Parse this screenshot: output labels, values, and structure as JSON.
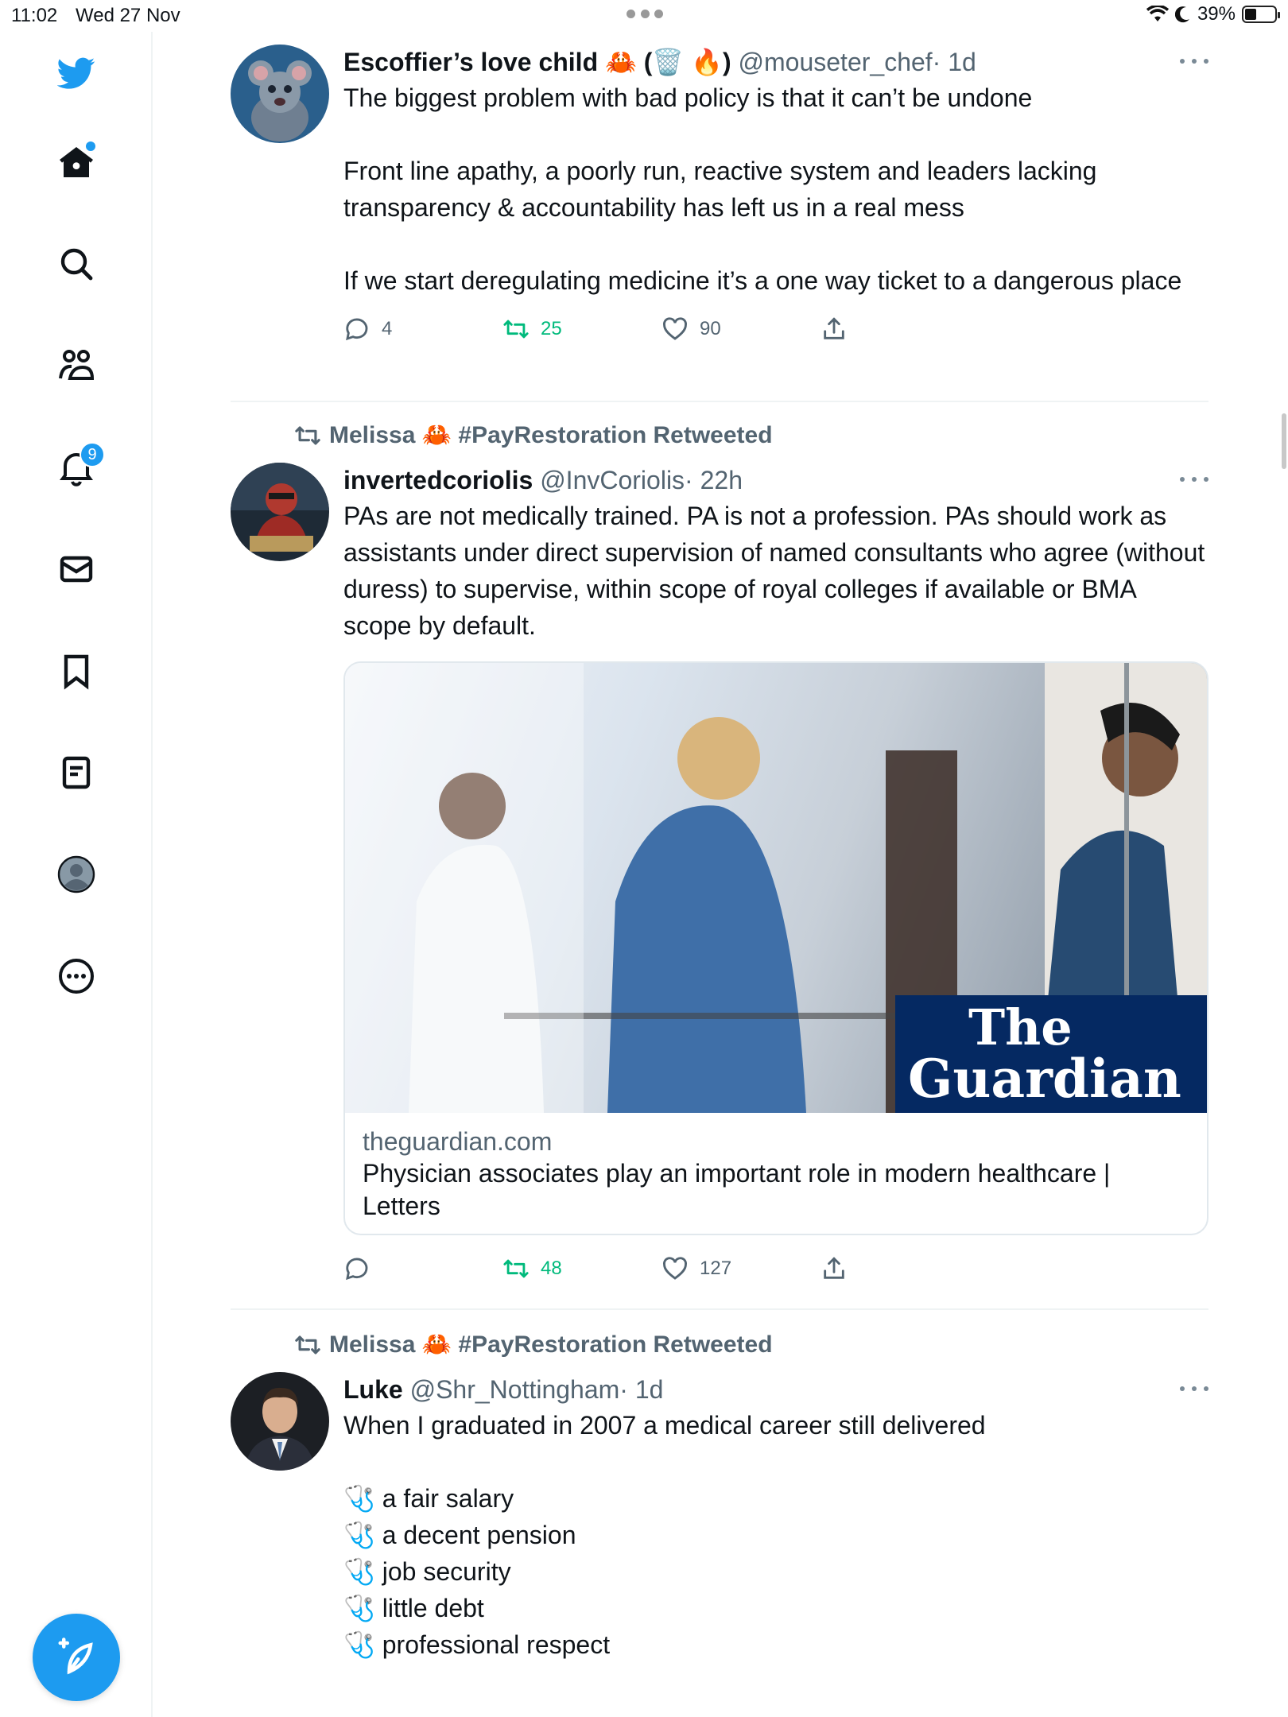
{
  "status_bar": {
    "time": "11:02",
    "date": "Wed 27 Nov",
    "battery": "39%"
  },
  "sidebar": {
    "items": [
      {
        "name": "twitter-logo"
      },
      {
        "name": "home"
      },
      {
        "name": "explore"
      },
      {
        "name": "communities"
      },
      {
        "name": "notifications",
        "badge": "9"
      },
      {
        "name": "messages"
      },
      {
        "name": "bookmarks"
      },
      {
        "name": "lists"
      },
      {
        "name": "profile"
      },
      {
        "name": "more"
      }
    ]
  },
  "feed": {
    "tweets": [
      {
        "name": "Escoffier’s love child 🦀 (🗑️ 🔥)",
        "handle": "@mouseter_chef",
        "time": "· 1d",
        "text": "The biggest problem with bad policy is that it can’t be undone\n\nFront line apathy, a poorly run, reactive system and leaders lacking transparency & accountability has left us in a real mess\n\nIf we start deregulating medicine it’s a one way ticket to a dangerous place",
        "replies": "4",
        "retweets": "25",
        "likes": "90"
      },
      {
        "retweeted_by": "Melissa 🦀 #PayRestoration Retweeted",
        "name": "invertedcoriolis",
        "handle": "@InvCoriolis",
        "time": "· 22h",
        "text": "PAs are not medically trained. PA is not a profession. PAs should work as assistants under direct supervision of named consultants who agree (without duress) to supervise, within scope of royal colleges if available or BMA scope by default.",
        "card": {
          "logo_line1": "The",
          "logo_line2": "Guardian",
          "domain": "theguardian.com",
          "title": "Physician associates play an important role in modern healthcare | Letters"
        },
        "retweets": "48",
        "likes": "127"
      },
      {
        "retweeted_by": "Melissa 🦀 #PayRestoration Retweeted",
        "name": "Luke",
        "handle": "@Shr_Nottingham",
        "time": "· 1d",
        "text": "When I graduated in 2007 a medical career still delivered\n\n🩺 a fair salary\n🩺 a decent pension\n🩺 job security\n🩺 little debt\n🩺 professional respect"
      }
    ]
  },
  "colors": {
    "accent": "#1d9bf0",
    "retweet": "#00ba7c",
    "muted": "#536471",
    "guardian": "#052962"
  }
}
